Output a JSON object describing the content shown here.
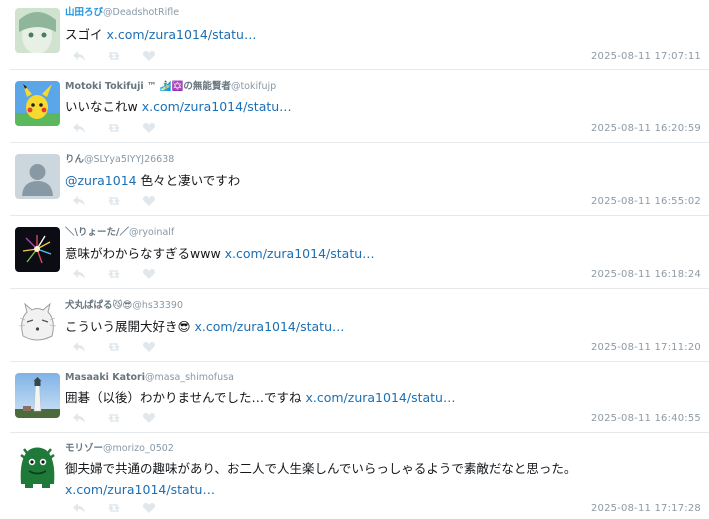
{
  "colors": {
    "link": "#1b6fb5",
    "name_blue": "#1b95e0",
    "timestamp": "#8d9aa6",
    "divider": "#e6e9ec"
  },
  "action_icons": [
    "reply-icon",
    "retweet-icon",
    "like-icon"
  ],
  "tweets": [
    {
      "name": "山田ろび",
      "handle": "@DeadshotRifle",
      "text": "スゴイ ",
      "link": "x.com/zura1014/statu…",
      "time": "2025-08-11 17:07:11"
    },
    {
      "name": "Motoki Tokifuji ™ 🏄🏻‍♂️✡️の無能賢者",
      "handle": "@tokifujp",
      "text": "いいなこれw ",
      "link": "x.com/zura1014/statu…",
      "time": "2025-08-11 16:20:59"
    },
    {
      "name": "りん",
      "handle": "@SLYya5IYYJ26638",
      "mention": "@zura1014",
      "text": " 色々と凄いですわ",
      "time": "2025-08-11 16:55:02"
    },
    {
      "name": "＼\\りょーた/／",
      "handle": "@ryoinalf",
      "text": "意味がわからなすぎるwww ",
      "link": "x.com/zura1014/statu…",
      "time": "2025-08-11 16:18:24"
    },
    {
      "name": "犬丸ぱぱる😼😎",
      "handle": "@hs33390",
      "text": "こういう展開大好き😎 ",
      "link": "x.com/zura1014/statu…",
      "time": "2025-08-11 17:11:20"
    },
    {
      "name": "Masaaki Katori",
      "handle": "@masa_shimofusa",
      "text": "囲碁（以後）わかりませんでした…ですね ",
      "link": "x.com/zura1014/statu…",
      "time": "2025-08-11 16:40:55"
    },
    {
      "name": "モリゾー",
      "handle": "@morizo_0502",
      "text": "御夫婦で共通の趣味があり、お二人で人生楽しんでいらっしゃるようで素敵だなと思った。",
      "link": "x.com/zura1014/statu…",
      "time": "2025-08-11 17:17:28"
    }
  ]
}
